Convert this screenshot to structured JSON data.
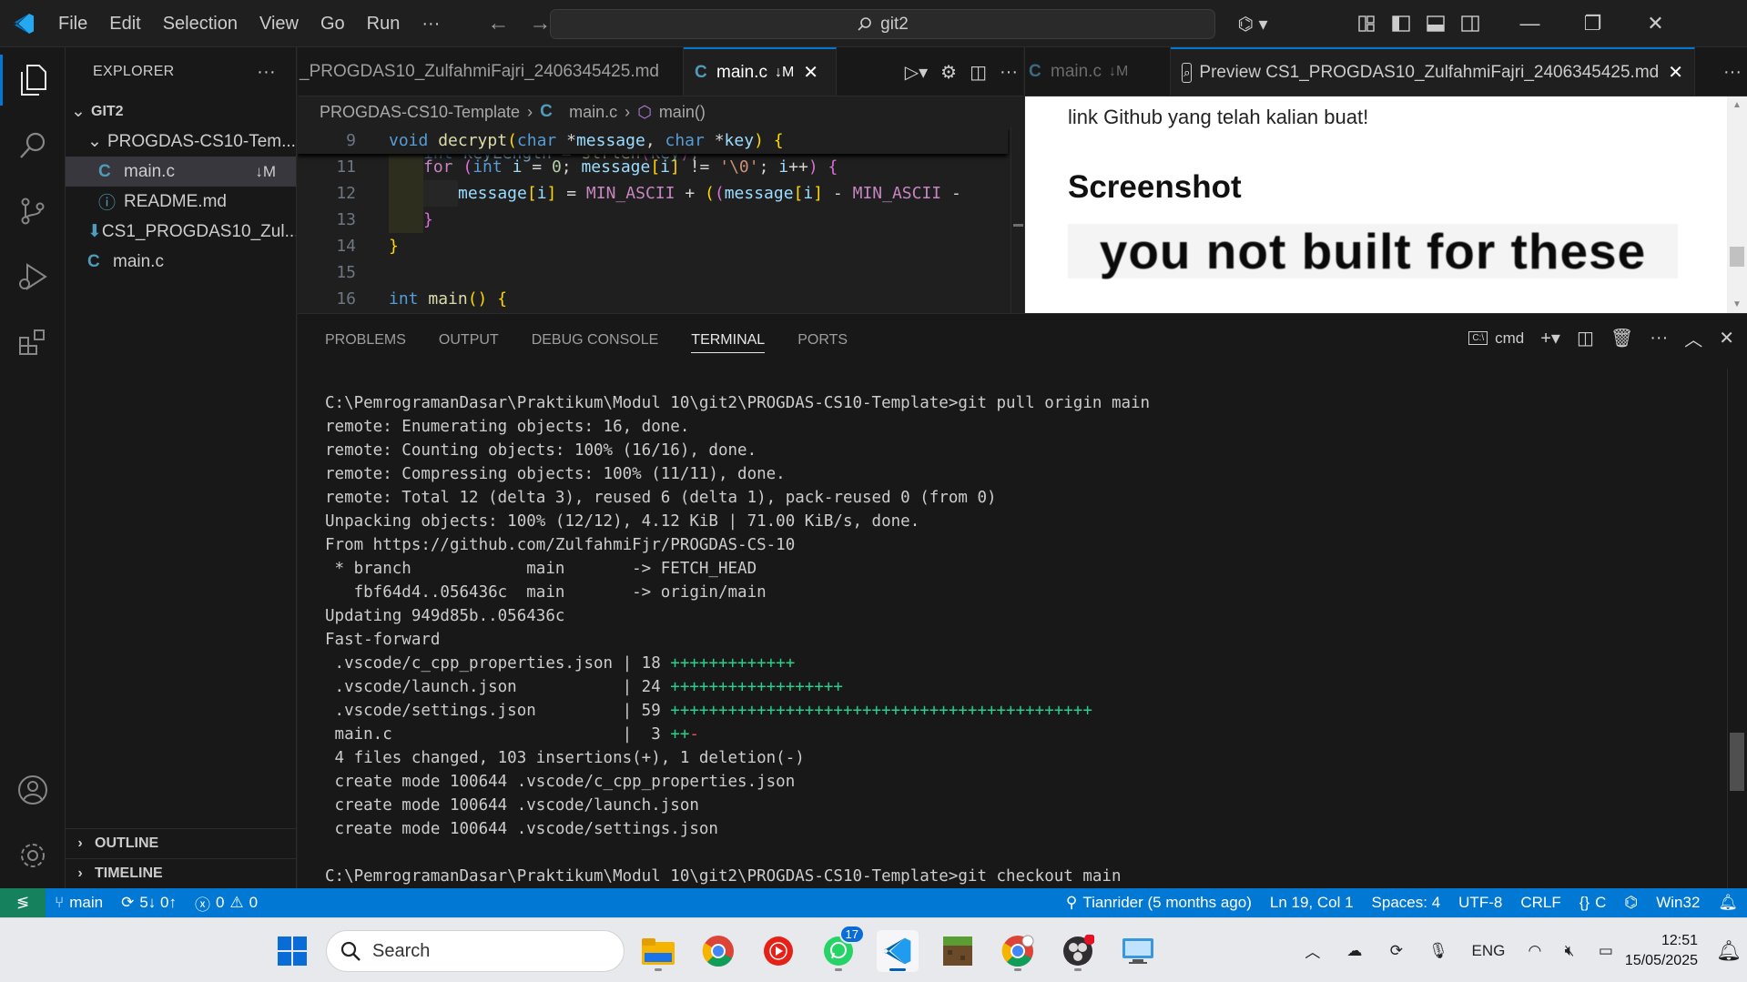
{
  "titlebar": {
    "menus": [
      "File",
      "Edit",
      "Selection",
      "View",
      "Go",
      "Run",
      "···"
    ],
    "search_text": "git2"
  },
  "sidebar": {
    "title": "EXPLORER",
    "root": "GIT2",
    "folder": "PROGDAS-CS10-Tem...",
    "files": [
      {
        "name": "main.c",
        "badge": "↓M",
        "icon": "c-file-icon",
        "selected": true
      },
      {
        "name": "README.md",
        "icon": "info-icon"
      },
      {
        "name": "CS1_PROGDAS10_Zul...",
        "icon": "markdown-file-icon"
      },
      {
        "name": "main.c",
        "icon": "c-file-icon"
      }
    ],
    "outline": "OUTLINE",
    "timeline": "TIMELINE"
  },
  "editor1": {
    "tabs": [
      {
        "label": "_PROGDAS10_ZulfahmiFajri_2406345425.md"
      },
      {
        "label": "main.c",
        "mod": "↓M",
        "active": true
      }
    ],
    "breadcrumb": [
      "PROGDAS-CS10-Template",
      "main.c",
      "main()"
    ],
    "sticky": {
      "num": "9",
      "text": "void decrypt(char *message, char *key) {"
    },
    "lines": [
      {
        "num": "11"
      },
      {
        "num": "12"
      },
      {
        "num": "13"
      },
      {
        "num": "14"
      },
      {
        "num": "15"
      },
      {
        "num": "16"
      }
    ]
  },
  "editor2": {
    "tabs": [
      {
        "label": "main.c",
        "mod": "↓M"
      },
      {
        "label": "Preview CS1_PROGDAS10_ZulfahmiFajri_2406345425.md"
      }
    ],
    "preview_text": "link Github yang telah kalian buat!",
    "preview_heading": "Screenshot",
    "preview_image_text": "you not built for these"
  },
  "panel": {
    "tabs": [
      "PROBLEMS",
      "OUTPUT",
      "DEBUG CONSOLE",
      "TERMINAL",
      "PORTS"
    ],
    "active_tab": "TERMINAL",
    "shell": "cmd",
    "terminal_lines": [
      "C:\\PemrogramanDasar\\Praktikum\\Modul 10\\git2\\PROGDAS-CS10-Template>git pull origin main",
      "remote: Enumerating objects: 16, done.",
      "remote: Counting objects: 100% (16/16), done.",
      "remote: Compressing objects: 100% (11/11), done.",
      "remote: Total 12 (delta 3), reused 6 (delta 1), pack-reused 0 (from 0)",
      "Unpacking objects: 100% (12/12), 4.12 KiB | 71.00 KiB/s, done.",
      "From https://github.com/ZulfahmiFjr/PROGDAS-CS-10",
      " * branch            main       -> FETCH_HEAD",
      "   fbf64d4..056436c  main       -> origin/main",
      "Updating 949d85b..056436c",
      "Fast-forward"
    ],
    "diffstat": [
      {
        "file": " .vscode/c_cpp_properties.json | 18 ",
        "plus": "+++++++++++++",
        "minus": ""
      },
      {
        "file": " .vscode/launch.json           | 24 ",
        "plus": "++++++++++++++++++",
        "minus": ""
      },
      {
        "file": " .vscode/settings.json         | 59 ",
        "plus": "++++++++++++++++++++++++++++++++++++++++++++",
        "minus": ""
      },
      {
        "file": " main.c                        |  3 ",
        "plus": "++",
        "minus": "-"
      }
    ],
    "terminal_tail": [
      " 4 files changed, 103 insertions(+), 1 deletion(-)",
      " create mode 100644 .vscode/c_cpp_properties.json",
      " create mode 100644 .vscode/launch.json",
      " create mode 100644 .vscode/settings.json",
      "",
      "C:\\PemrogramanDasar\\Praktikum\\Modul 10\\git2\\PROGDAS-CS10-Template>git checkout main"
    ]
  },
  "statusbar": {
    "branch": "main",
    "sync": "5↓ 0↑",
    "errors": "0",
    "warnings": "0",
    "blame": "Tianrider (5 months ago)",
    "position": "Ln 19, Col 1",
    "spaces": "Spaces: 4",
    "encoding": "UTF-8",
    "eol": "CRLF",
    "language": "C",
    "platform": "Win32"
  },
  "taskbar": {
    "search_placeholder": "Search",
    "whatsapp_badge": "17",
    "language": "ENG",
    "time": "12:51",
    "date": "15/05/2025"
  },
  "colors": {
    "accent": "#0078d4",
    "statusbar": "#0078d4",
    "remote": "#16825d",
    "diff_plus": "#23d18b",
    "diff_minus": "#f14c4c"
  }
}
